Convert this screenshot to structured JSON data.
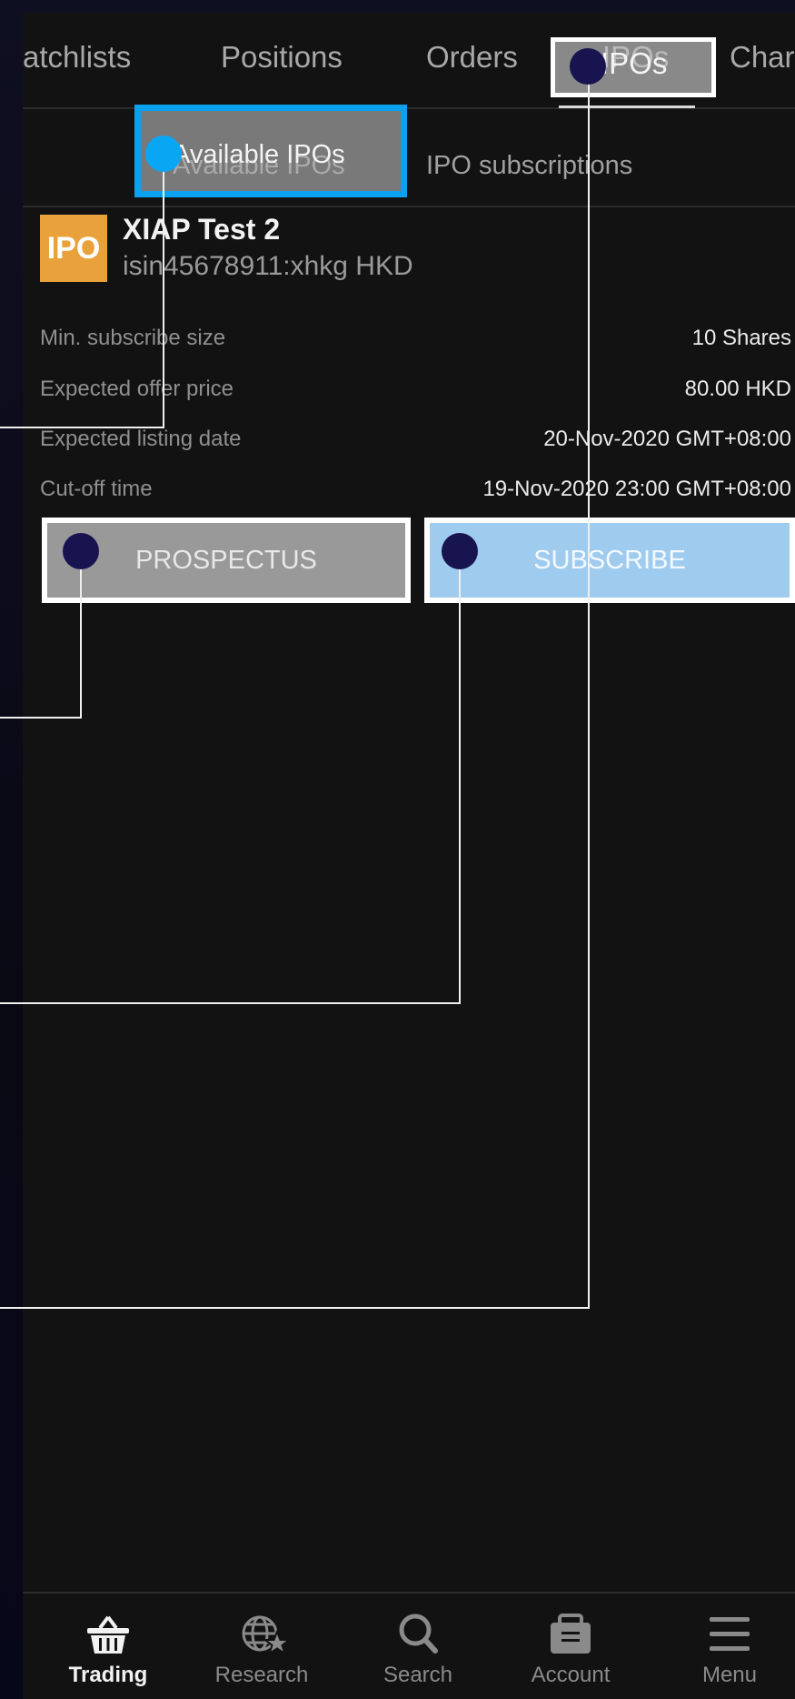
{
  "top_tabs": [
    "atchlists",
    "Positions",
    "Orders",
    "IPOs",
    "Char"
  ],
  "sub_tabs": [
    "Available IPOs",
    "IPO subscriptions"
  ],
  "ipo": {
    "icon_text": "IPO",
    "name": "XIAP Test 2",
    "identifier": "isin45678911:xhkg HKD",
    "rows": [
      {
        "label": "Min. subscribe size",
        "value": "10 Shares"
      },
      {
        "label": "Expected offer price",
        "value": "80.00 HKD"
      },
      {
        "label": "Expected listing date",
        "value": "20-Nov-2020 GMT+08:00"
      },
      {
        "label": "Cut-off time",
        "value": "19-Nov-2020 23:00 GMT+08:00"
      }
    ],
    "prospectus_label": "PROSPECTUS",
    "subscribe_label": "SUBSCRIBE"
  },
  "bottom_nav": [
    {
      "label": "Trading",
      "icon": "basket-icon"
    },
    {
      "label": "Research",
      "icon": "globe-star-icon"
    },
    {
      "label": "Search",
      "icon": "search-icon"
    },
    {
      "label": "Account",
      "icon": "briefcase-icon"
    },
    {
      "label": "Menu",
      "icon": "hamburger-menu-icon"
    }
  ],
  "colors": {
    "background": "#121212",
    "ipo_icon": "#e9a23b",
    "highlight_blue": "#0aa2f0",
    "annotation_dot": "#17144f",
    "subscribe_fill": "#9fccee"
  }
}
